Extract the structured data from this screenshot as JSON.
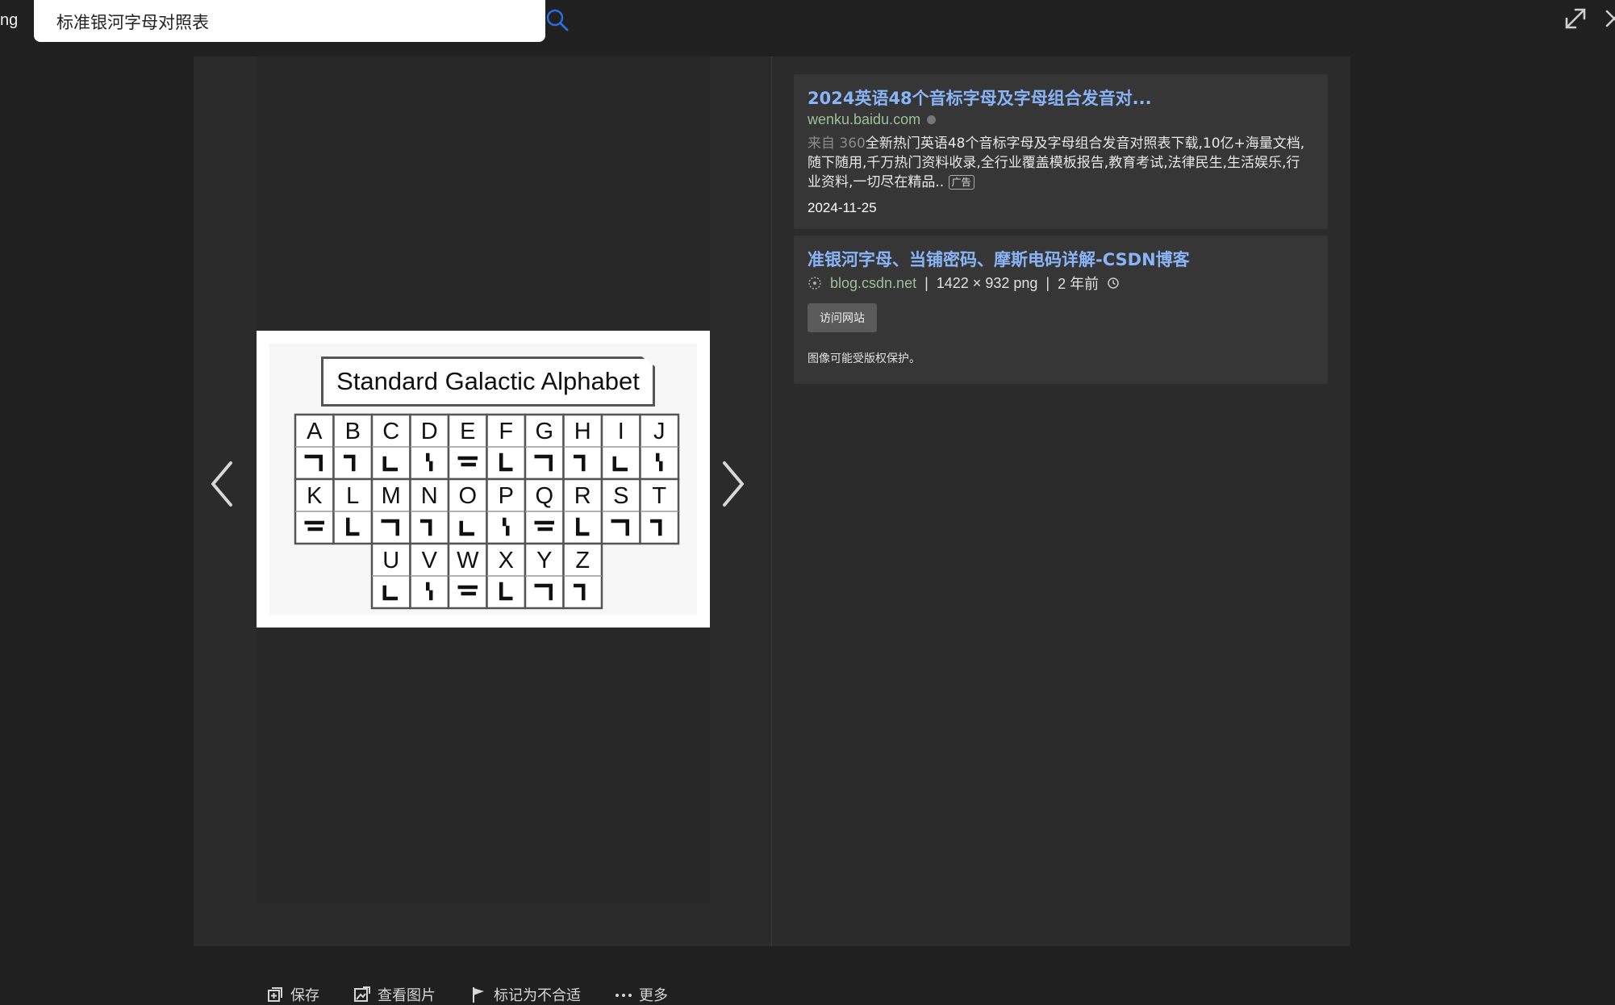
{
  "top_bar": {
    "brand_fragment": "ng",
    "search": {
      "value": "标准银河字母对照表"
    }
  },
  "viewer": {
    "preview_image": {
      "title": "Standard Galactic Alphabet",
      "rows": [
        [
          "A",
          "B",
          "C",
          "D",
          "E",
          "F",
          "G",
          "H",
          "I",
          "J"
        ],
        [
          "K",
          "L",
          "M",
          "N",
          "O",
          "P",
          "Q",
          "R",
          "S",
          "T"
        ],
        [
          "U",
          "V",
          "W",
          "X",
          "Y",
          "Z"
        ]
      ]
    },
    "actions": [
      {
        "label": "保存",
        "icon": "save-icon"
      },
      {
        "label": "查看图片",
        "icon": "view-image-icon"
      },
      {
        "label": "标记为不合适",
        "icon": "flag-icon"
      },
      {
        "label": "更多",
        "icon": "more-icon"
      }
    ]
  },
  "results": {
    "card1": {
      "title": "2024英语48个音标字母及字母组合发音对...",
      "source": "wenku.baidu.com",
      "desc_prefix": "来自 360",
      "desc": "全新热门英语48个音标字母及字母组合发音对照表下载,10亿+海量文档,随下随用,千万热门资料收录,全行业覆盖模板报告,教育考试,法律民生,生活娱乐,行业资料,一切尽在精品..",
      "ad_label": "广告",
      "date": "2024-11-25"
    },
    "card2": {
      "title": "准银河字母、当铺密码、摩斯电码详解-CSDN博客",
      "domain": "blog.csdn.net",
      "separator": "|",
      "dimensions": "1422 × 932 png",
      "age": "2 年前",
      "visit_button": "访问网站",
      "copyright": "图像可能受版权保护。"
    }
  }
}
